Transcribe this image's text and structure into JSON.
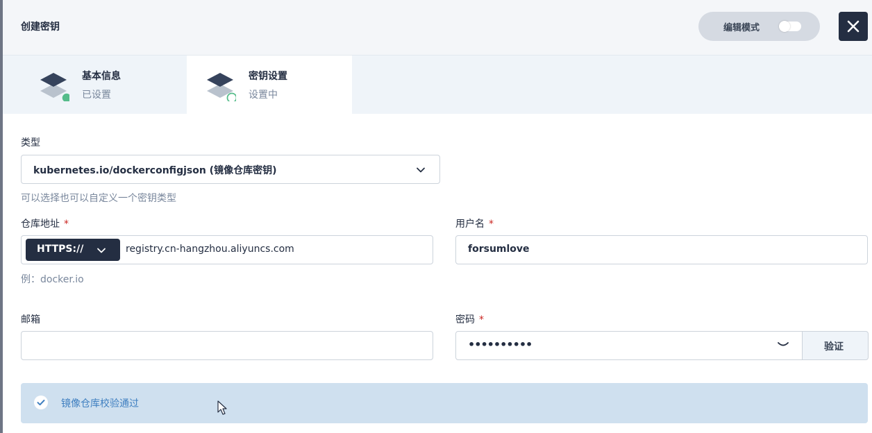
{
  "header": {
    "title": "创建密钥",
    "edit_mode_label": "编辑模式"
  },
  "steps": [
    {
      "title": "基本信息",
      "status": "已设置"
    },
    {
      "title": "密钥设置",
      "status": "设置中"
    }
  ],
  "form": {
    "type": {
      "label": "类型",
      "value": "kubernetes.io/dockerconfigjson (镜像仓库密钥)",
      "hint": "可以选择也可以自定义一个密钥类型"
    },
    "registry": {
      "label": "仓库地址",
      "required_mark": "*",
      "protocol": "HTTPS://",
      "value": "registry.cn-hangzhou.aliyuncs.com",
      "hint": "例：docker.io"
    },
    "username": {
      "label": "用户名",
      "required_mark": "*",
      "value": "forsumlove"
    },
    "email": {
      "label": "邮箱",
      "value": ""
    },
    "password": {
      "label": "密码",
      "required_mark": "*",
      "masked_value": "••••••••••",
      "verify_label": "验证"
    }
  },
  "alert": {
    "text": "镜像仓库校验通过"
  },
  "colors": {
    "dark": "#242e42",
    "success_green": "#55bc8a",
    "alert_bg": "#cfe0ef",
    "alert_text": "#3f7fc0",
    "required": "#ca2621"
  },
  "icons": [
    "close-icon",
    "layers-icon",
    "chevron-down-icon",
    "eye-closed-icon",
    "check-circle-icon",
    "mouse-cursor-icon"
  ]
}
